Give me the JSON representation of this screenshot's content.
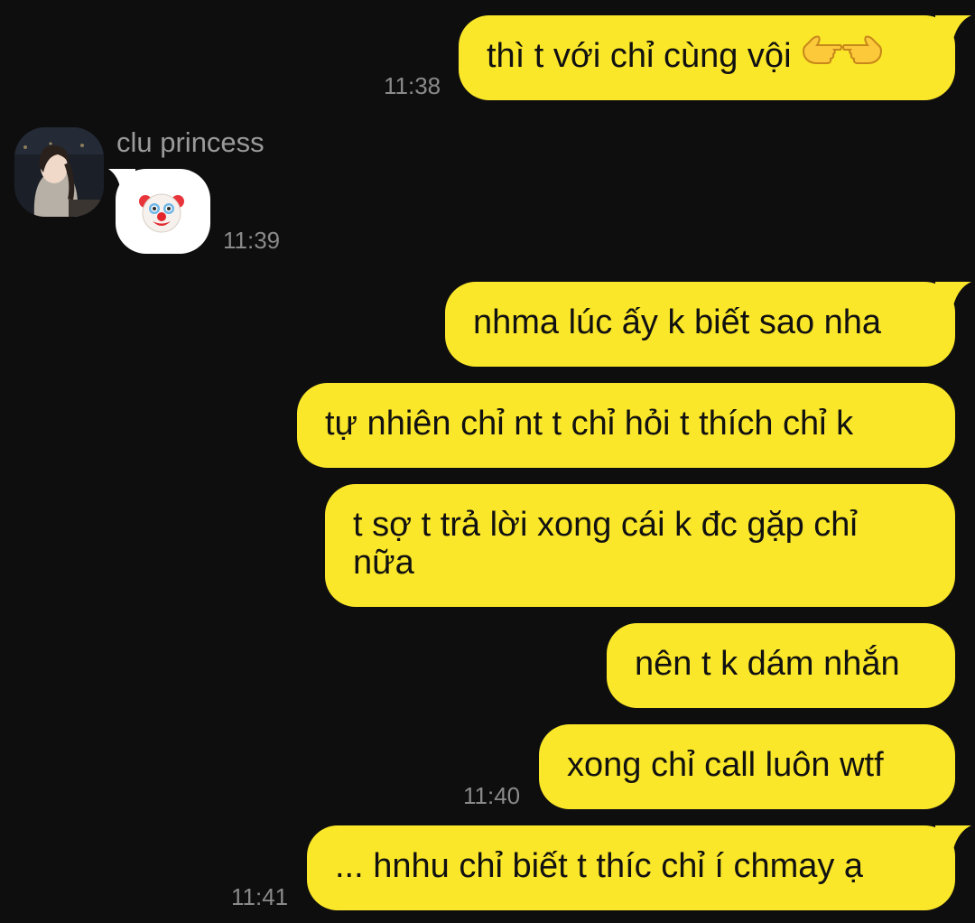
{
  "contact": {
    "name": "clu princess"
  },
  "messages": [
    {
      "direction": "sent",
      "text": "thì t với chỉ cùng vội",
      "emoji": [
        "backhand-index-pointing-left",
        "backhand-index-pointing-right"
      ],
      "time": "11:38"
    },
    {
      "direction": "received",
      "emoji": "clown-face",
      "time": "11:39"
    },
    {
      "direction": "sent",
      "text": "nhma lúc ấy k biết sao nha"
    },
    {
      "direction": "sent",
      "text": "tự nhiên chỉ nt t chỉ hỏi t thích chỉ k"
    },
    {
      "direction": "sent",
      "lines": [
        "t sợ t trả lời xong cái k đc gặp chỉ",
        "nữa"
      ]
    },
    {
      "direction": "sent",
      "text": "nên t k dám nhắn"
    },
    {
      "direction": "sent",
      "text": "xong chỉ call luôn wtf",
      "time": "11:40"
    },
    {
      "direction": "sent",
      "text": "... hnhu chỉ biết t thíc chỉ í chmay ạ",
      "time": "11:41"
    }
  ],
  "colors": {
    "background": "#0e0e0f",
    "sent_bubble": "#fbe729",
    "received_bubble": "#ffffff",
    "timestamp": "#8a8a8a",
    "sender_name": "#9a9a9a"
  }
}
